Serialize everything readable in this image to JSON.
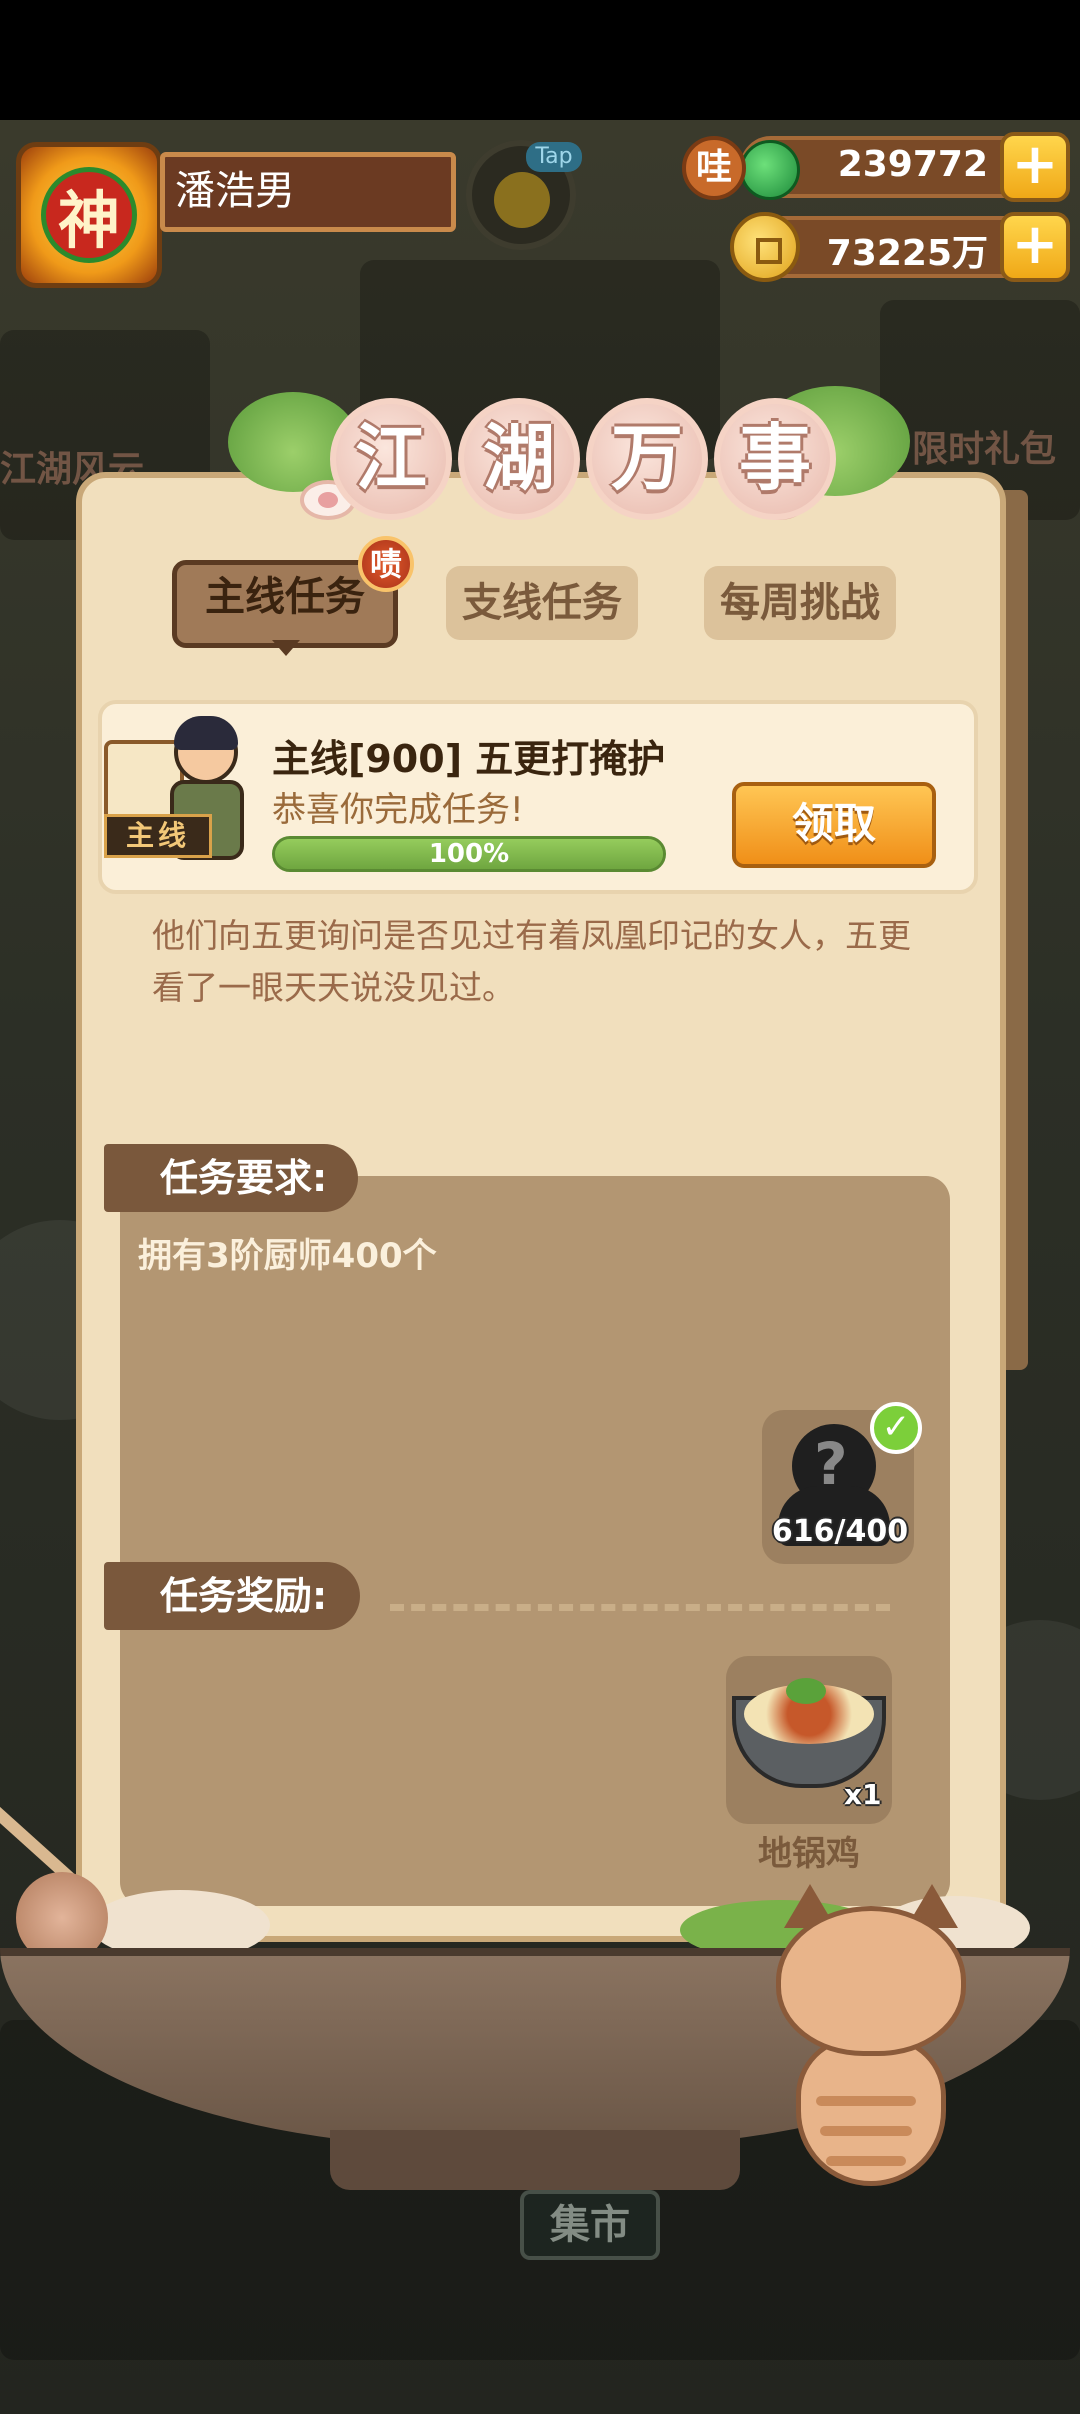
{
  "player": {
    "name": "潘浩男",
    "avatar_glyph": "神"
  },
  "top_bar": {
    "tap_label": "Tap",
    "currency_jade": {
      "icon_label": "哇",
      "value": "239772",
      "add": "+"
    },
    "currency_coin": {
      "value": "73225万",
      "add": "+"
    }
  },
  "background": {
    "limited_gift": "限时礼包",
    "left_label": "江湖风云",
    "market": "集市"
  },
  "panel": {
    "title_chars": [
      "江",
      "湖",
      "万",
      "事"
    ],
    "tabs": [
      {
        "label": "主线任务",
        "active": true
      },
      {
        "label": "支线任务",
        "active": false
      },
      {
        "label": "每周挑战",
        "active": false
      }
    ],
    "tab_badge": "啧",
    "task": {
      "tag": "主线",
      "title": "主线[900] 五更打掩护",
      "status": "恭喜你完成任务!",
      "progress_text": "100%",
      "progress_fraction": 1.0,
      "claim_label": "领取"
    },
    "story": "他们向五更询问是否见过有着凤凰印记的女人，五更看了一眼天天说没见过。",
    "requirements": {
      "header": "任务要求:",
      "text": "拥有3阶厨师400个",
      "item_count": "616/400",
      "check": "✓",
      "unknown_mark": "?"
    },
    "rewards": {
      "header": "任务奖励:",
      "item_name": "地锅鸡",
      "item_qty": "x1"
    }
  },
  "colors": {
    "panel_bg": "#f1dfbd",
    "section_tab": "#7a583c",
    "claim_button": "#f08f18",
    "progress_green": "#7ab24a"
  }
}
